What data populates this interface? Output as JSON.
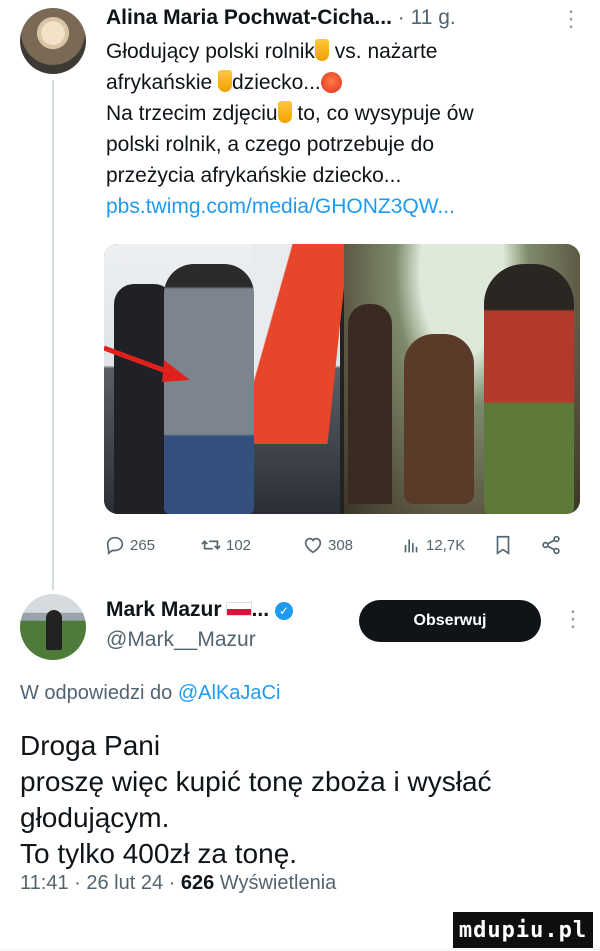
{
  "tweet_original": {
    "author_name": "Alina Maria Pochwat-Cicha...",
    "time": " · 11 g.",
    "more": "⋮",
    "body": {
      "line1_a": "Głodujący polski rolnik",
      "line1_b": " vs. nażarte",
      "line2_a": "afrykańskie ",
      "line2_b": "dziecko...",
      "line3_a": "Na trzecim zdjęciu",
      "line3_b": " to, co wysypuje ów",
      "line4": "polski rolnik, a czego potrzebuje do",
      "line5": "przeżycia afrykańskie dziecko...",
      "link": "pbs.twimg.com/media/GHONZ3QW..."
    },
    "actions": {
      "replies": "265",
      "retweets": "102",
      "likes": "308",
      "views": "12,7K"
    }
  },
  "reply": {
    "author_name": "Mark Mazur",
    "name_suffix": "...",
    "handle": "@Mark__Mazur",
    "follow_label": "Obserwuj",
    "more": "⋮",
    "reply_prefix": "W odpowiedzi do ",
    "reply_handle": "@AlKaJaCi",
    "body": [
      "Droga Pani",
      "proszę więc kupić tonę zboża i wysłać",
      "głodującym.",
      "To tylko 400zł za tonę."
    ],
    "footer": {
      "time": "11:41 · 26 lut 24 · ",
      "views": "626",
      "views_label": " Wyświetlenia"
    }
  },
  "watermark": "mdupiu.pl",
  "colors": {
    "link": "#1d9bf0",
    "text": "#0f1419",
    "muted": "#536471",
    "button_bg": "#0f1419"
  }
}
